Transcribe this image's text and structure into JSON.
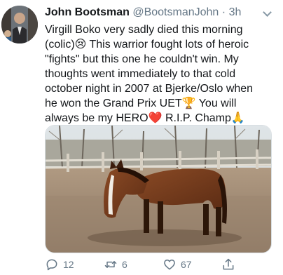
{
  "tweet": {
    "author_name": "John Bootsman",
    "handle": "@BootsmanJohn",
    "separator": "·",
    "time": "3h",
    "text_lines": [
      "Virgill Boko very sadly died this morning",
      "(colic)😢 This warrior fought lots of heroic",
      "\"fights\" but this one he couldn't win. My",
      "thoughts went immediately to that cold",
      "october night in 2007 at Bjerke/Oslo when",
      "he won the Grand Prix UET🏆 You will",
      "always be my HERO❤️ R.I.P. Champ🙏"
    ]
  },
  "actions": {
    "replies": "12",
    "retweets": "6",
    "likes": "67"
  },
  "icons": {
    "reply": "reply-icon",
    "retweet": "retweet-icon",
    "like": "heart-icon",
    "share": "share-icon",
    "more": "chevron-down-icon"
  },
  "colors": {
    "text": "#14171a",
    "muted": "#657786"
  }
}
